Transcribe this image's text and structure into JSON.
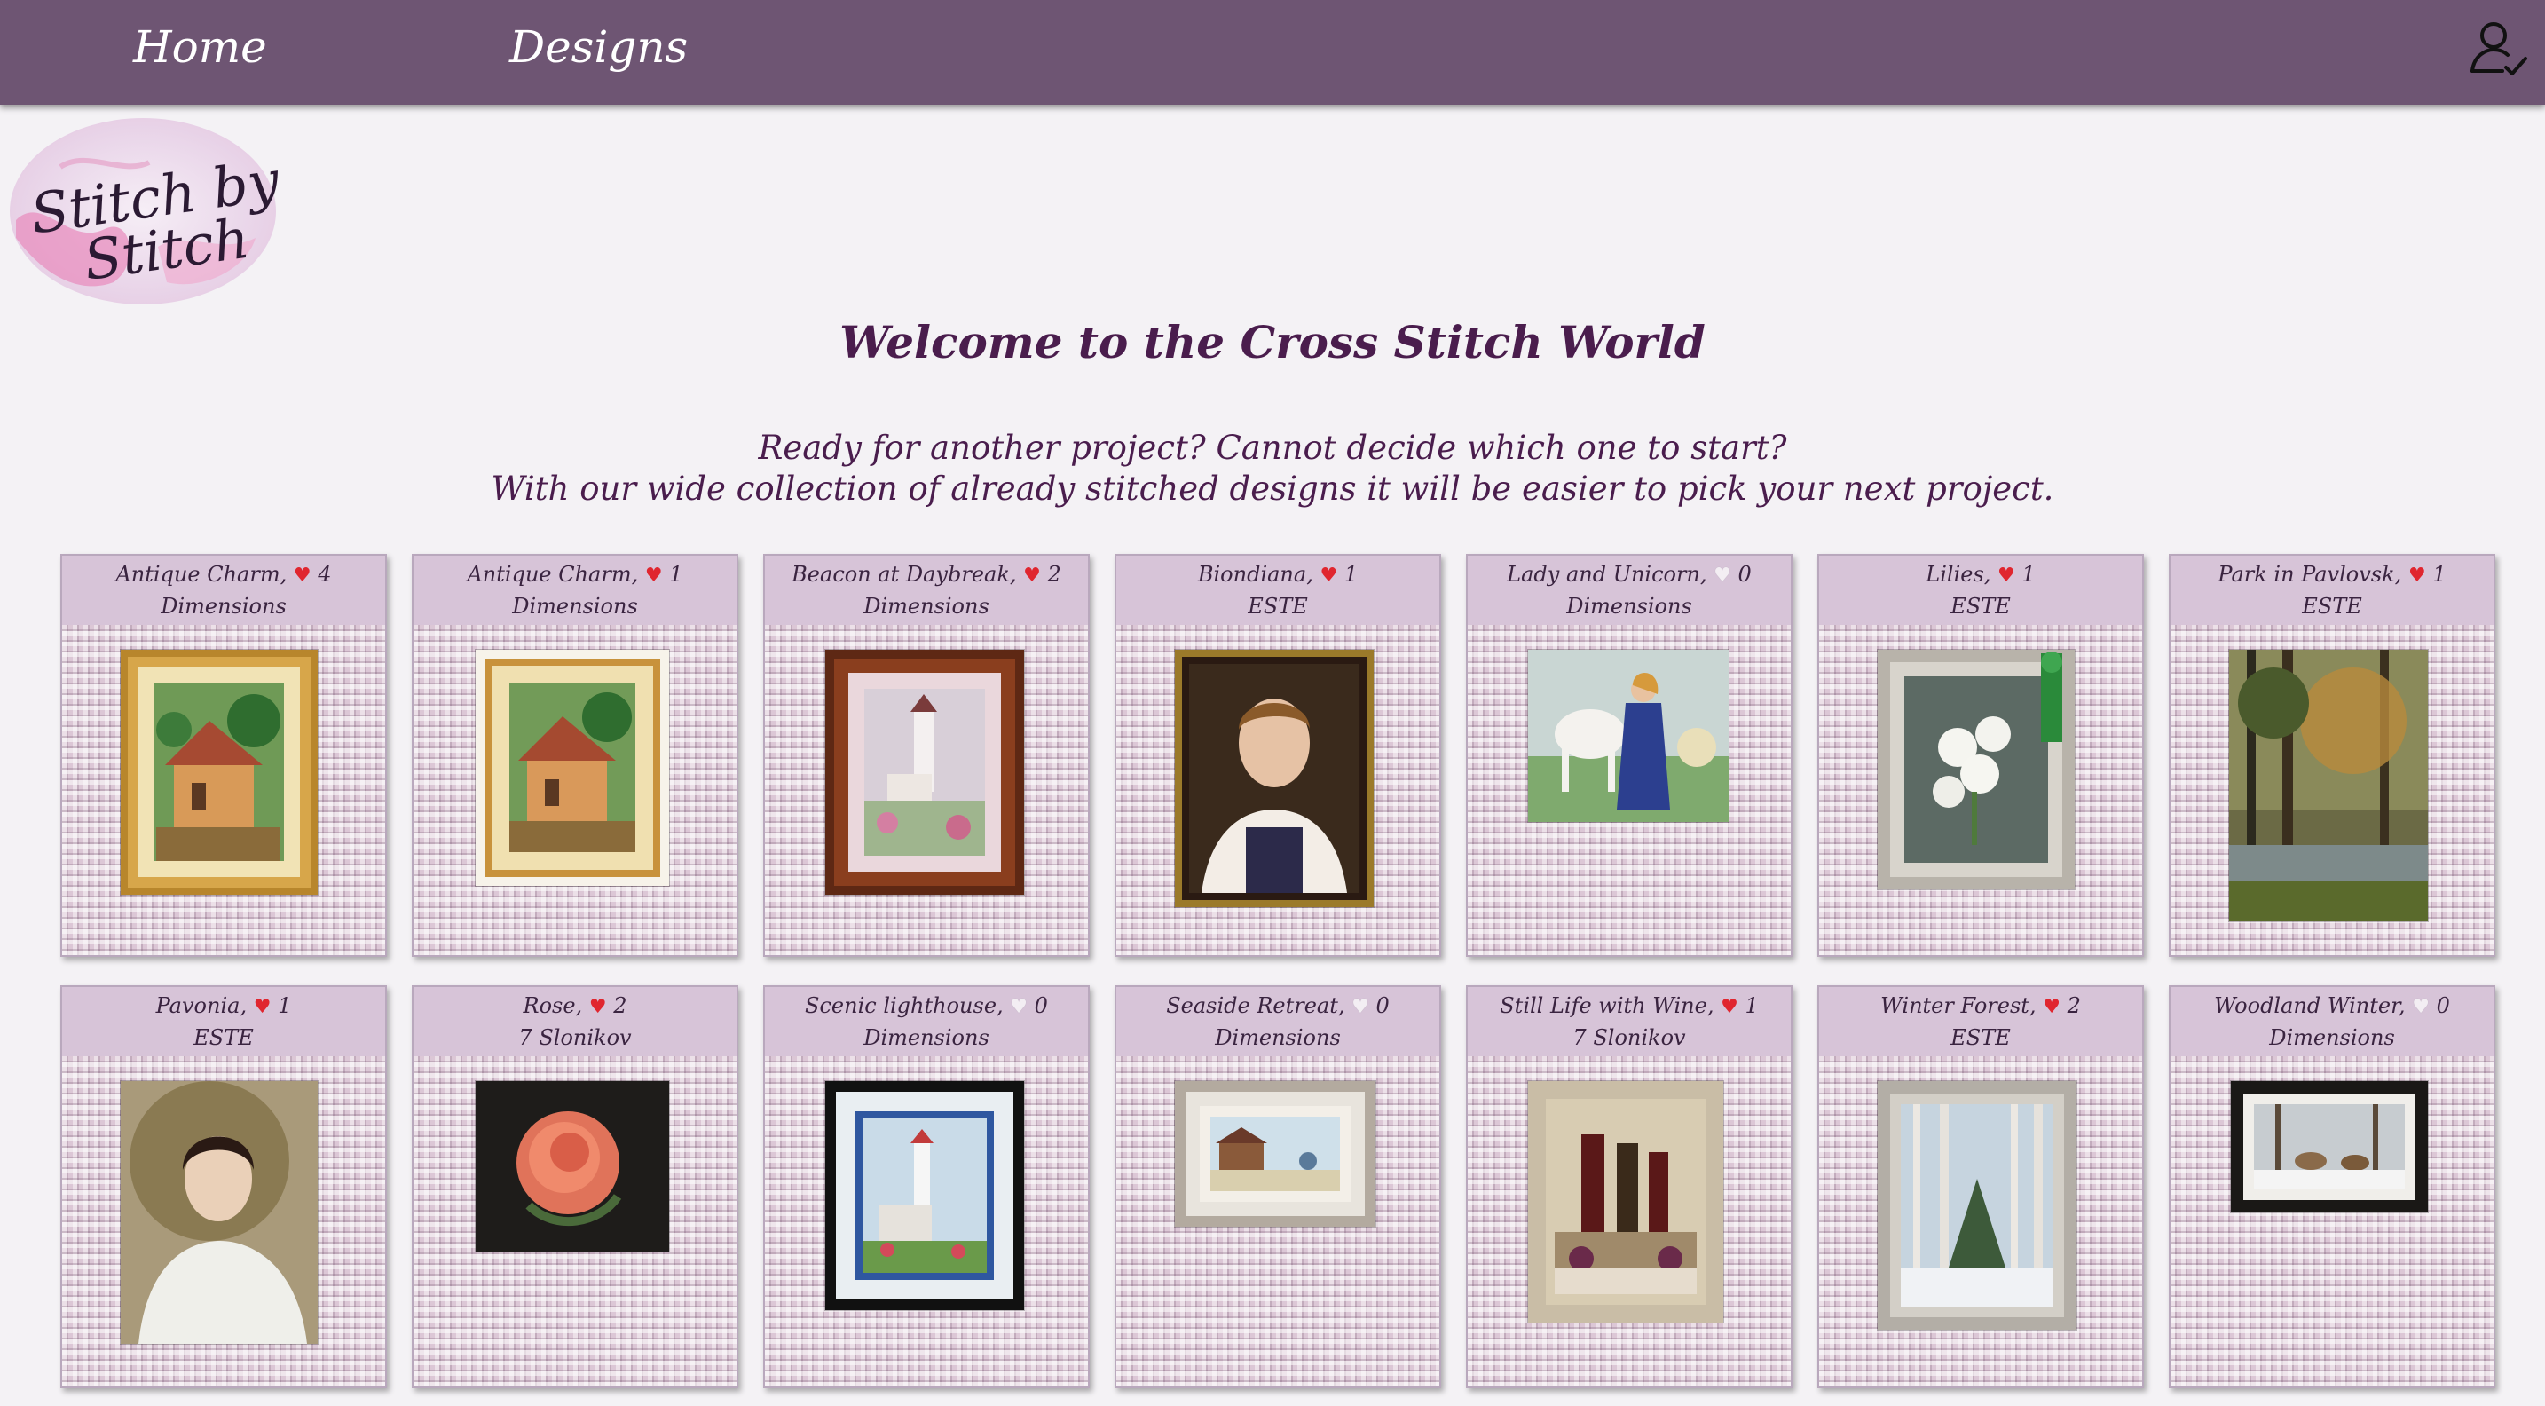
{
  "nav": {
    "home_label": "Home",
    "designs_label": "Designs",
    "user_icon": "user-check-icon"
  },
  "logo": {
    "text_line1": "Stitch by",
    "text_line2": "Stitch"
  },
  "page": {
    "title": "Welcome to the Cross Stitch World",
    "intro_line1": "Ready for another project? Cannot decide which one to start?",
    "intro_line2": "With our wide collection of already stitched designs it will be easier to pick your next project."
  },
  "colors": {
    "navbar": "#6e5573",
    "accent": "#4a1d4d",
    "card_header": "#d7c4d8",
    "heart": "#e0262f"
  },
  "designs": [
    {
      "name": "Antique Charm,",
      "likes": "4",
      "liked": true,
      "maker": "Dimensions"
    },
    {
      "name": "Antique Charm,",
      "likes": "1",
      "liked": true,
      "maker": "Dimensions"
    },
    {
      "name": "Beacon at Daybreak,",
      "likes": "2",
      "liked": true,
      "maker": "Dimensions"
    },
    {
      "name": "Biondiana,",
      "likes": "1",
      "liked": true,
      "maker": "ESTE"
    },
    {
      "name": "Lady and Unicorn,",
      "likes": "0",
      "liked": false,
      "maker": "Dimensions"
    },
    {
      "name": "Lilies,",
      "likes": "1",
      "liked": true,
      "maker": "ESTE"
    },
    {
      "name": "Park in Pavlovsk,",
      "likes": "1",
      "liked": true,
      "maker": "ESTE"
    },
    {
      "name": "Pavonia,",
      "likes": "1",
      "liked": true,
      "maker": "ESTE"
    },
    {
      "name": "Rose,",
      "likes": "2",
      "liked": true,
      "maker": "7 Slonikov"
    },
    {
      "name": "Scenic lighthouse,",
      "likes": "0",
      "liked": false,
      "maker": "Dimensions"
    },
    {
      "name": "Seaside Retreat,",
      "likes": "0",
      "liked": false,
      "maker": "Dimensions"
    },
    {
      "name": "Still Life with Wine,",
      "likes": "1",
      "liked": true,
      "maker": "7 Slonikov"
    },
    {
      "name": "Winter Forest,",
      "likes": "2",
      "liked": true,
      "maker": "ESTE"
    },
    {
      "name": "Woodland Winter,",
      "likes": "0",
      "liked": false,
      "maker": "Dimensions"
    }
  ]
}
